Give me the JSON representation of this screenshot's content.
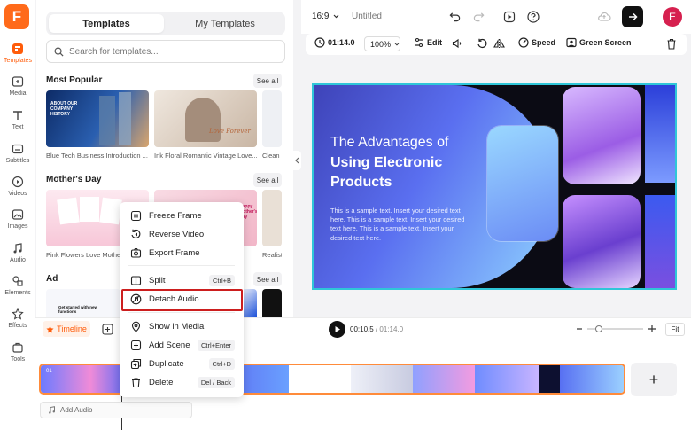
{
  "app": {
    "logo_letter": "F",
    "accent": "#ff6a1a"
  },
  "rail": [
    {
      "label": "Templates",
      "icon": "templates-icon"
    },
    {
      "label": "Media",
      "icon": "media-icon"
    },
    {
      "label": "Text",
      "icon": "text-icon"
    },
    {
      "label": "Subtitles",
      "icon": "subtitles-icon"
    },
    {
      "label": "Videos",
      "icon": "videos-icon"
    },
    {
      "label": "Images",
      "icon": "images-icon"
    },
    {
      "label": "Audio",
      "icon": "audio-icon"
    },
    {
      "label": "Elements",
      "icon": "elements-icon"
    },
    {
      "label": "Effects",
      "icon": "effects-icon"
    },
    {
      "label": "Tools",
      "icon": "tools-icon"
    }
  ],
  "panel": {
    "tabs": [
      "Templates",
      "My Templates"
    ],
    "search_placeholder": "Search for templates...",
    "see_all": "See all",
    "sections": [
      {
        "title": "Most Popular",
        "captions": [
          "Blue Tech Business Introduction ...",
          "Ink Floral Romantic Vintage Love...",
          "Clean I"
        ]
      },
      {
        "title": "Mother's Day",
        "captions": [
          "Pink Flowers Love Mothe",
          "",
          "Realist"
        ]
      },
      {
        "title": "Ad",
        "captions": []
      }
    ],
    "thumb_texts": {
      "about": "ABOUT OUR COMPANY HISTORY",
      "love": "Love Forever",
      "happy": "Happy Mother's Day",
      "ad": "Get started with new functions"
    }
  },
  "topbar": {
    "ratio": "16:9",
    "project": "Untitled",
    "avatar": "E"
  },
  "toolbar": {
    "duration": "01:14.0",
    "zoom": "100%",
    "edit": "Edit",
    "speed": "Speed",
    "green_screen": "Green Screen"
  },
  "slide": {
    "line1": "The Advantages of",
    "line2": "Using Electronic",
    "line3": "Products",
    "body": "This is a sample text. Insert your desired text here. This is a sample text. Insert your desired text here. This is a sample text. Insert your desired text here."
  },
  "timeline": {
    "label": "Timeline",
    "time_current": "00:10.5",
    "time_total": "01:14.0",
    "zoom_value": 0.2,
    "fit": "Fit",
    "add_audio": "Add Audio",
    "add_clip": "+",
    "clip_label": "01"
  },
  "context_menu": {
    "items": [
      {
        "label": "Freeze Frame",
        "icon": "freeze-frame-icon",
        "shortcut": ""
      },
      {
        "label": "Reverse Video",
        "icon": "reverse-video-icon",
        "shortcut": ""
      },
      {
        "label": "Export Frame",
        "icon": "export-frame-icon",
        "shortcut": ""
      },
      {
        "label": "Split",
        "icon": "split-icon",
        "shortcut": "Ctrl+B"
      },
      {
        "label": "Detach Audio",
        "icon": "detach-audio-icon",
        "shortcut": ""
      },
      {
        "label": "Show in Media",
        "icon": "location-pin-icon",
        "shortcut": ""
      },
      {
        "label": "Add Scene",
        "icon": "add-scene-icon",
        "shortcut": "Ctrl+Enter"
      },
      {
        "label": "Duplicate",
        "icon": "duplicate-icon",
        "shortcut": "Ctrl+D"
      },
      {
        "label": "Delete",
        "icon": "trash-icon",
        "shortcut": "Del / Back"
      }
    ],
    "highlight_color": "#cc1e1e"
  }
}
